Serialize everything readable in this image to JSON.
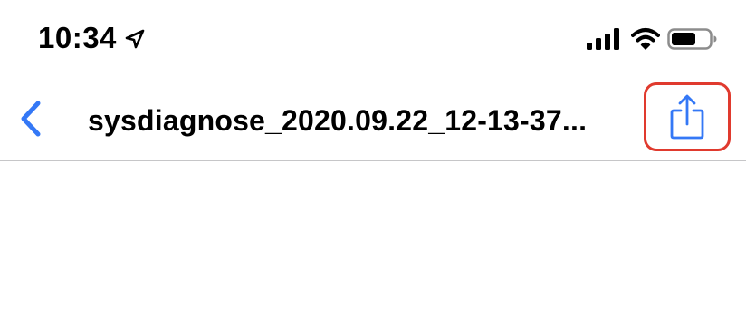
{
  "status_bar": {
    "time": "10:34",
    "icons": {
      "location": "location-arrow-icon",
      "signal": "cellular-signal-icon",
      "wifi": "wifi-icon",
      "battery": "battery-icon"
    }
  },
  "nav_bar": {
    "back_icon": "chevron-left-icon",
    "title": "sysdiagnose_2020.09.22_12-13-37...",
    "share_icon": "share-icon",
    "accent_color": "#3478f6",
    "highlight_color": "#e03a2e"
  }
}
